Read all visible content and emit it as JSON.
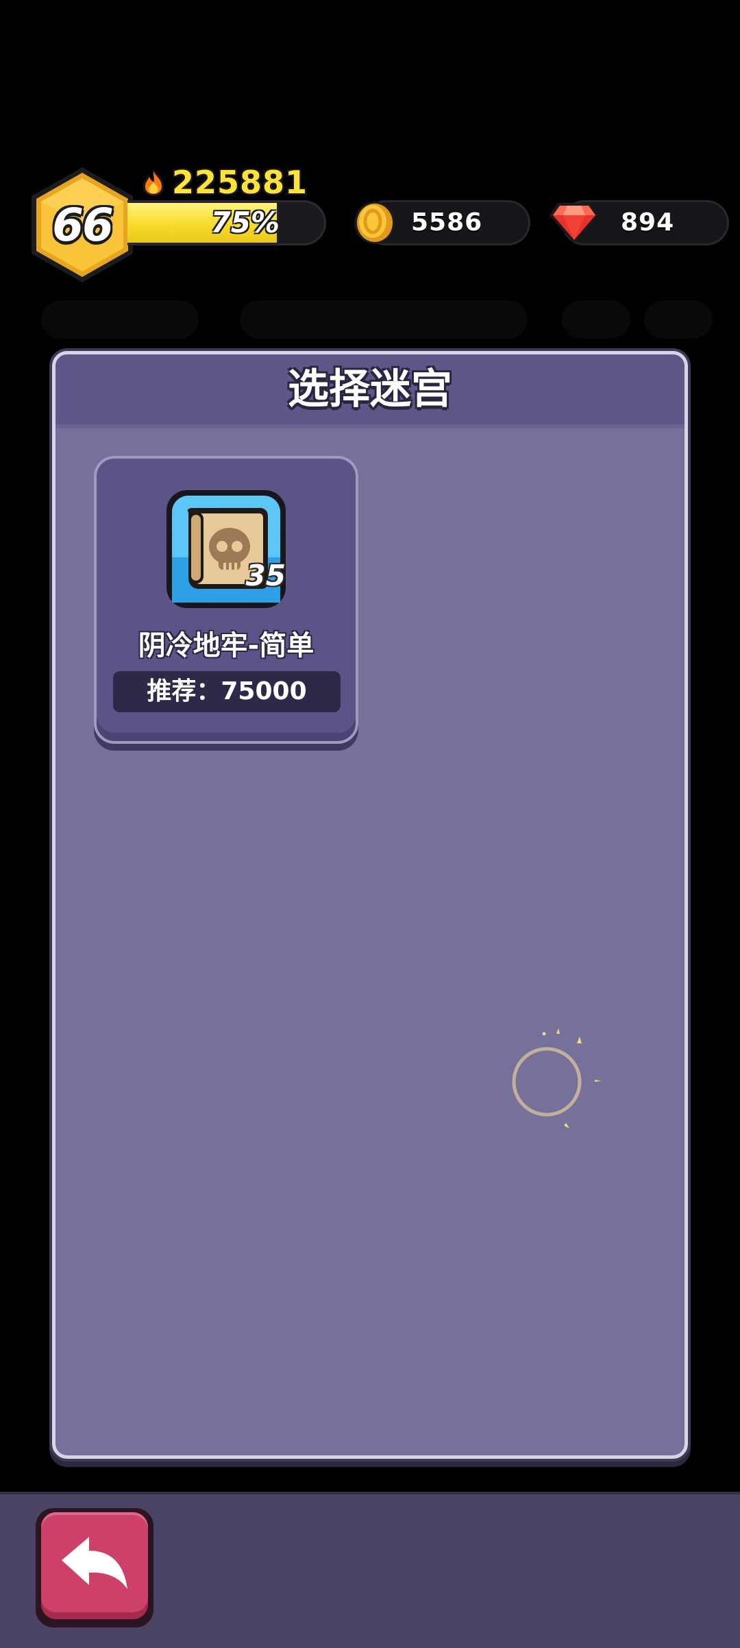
{
  "player": {
    "level": "66",
    "power": "225881",
    "xp_percent_label": "75%",
    "xp_fraction": 0.75
  },
  "currencies": {
    "coins": "5586",
    "gems": "894"
  },
  "panel": {
    "title": "选择迷宫",
    "mazes": [
      {
        "name": "阴冷地牢-简单",
        "level": "35",
        "recommend": "推荐：75000",
        "icon": "skull-scroll-icon"
      }
    ]
  },
  "icons": {
    "power": "flame-icon",
    "coin": "gold-coin-icon",
    "gem": "red-gem-icon",
    "back": "back-arrow-icon"
  },
  "colors": {
    "panel_bg": "#75719b",
    "panel_header": "#5e5889",
    "card_bg": "#5b5587",
    "xp_fill": "#f8db2c",
    "power_text": "#ffe23a",
    "back_button": "#cd4068",
    "bottom_bar": "#4b4363"
  }
}
